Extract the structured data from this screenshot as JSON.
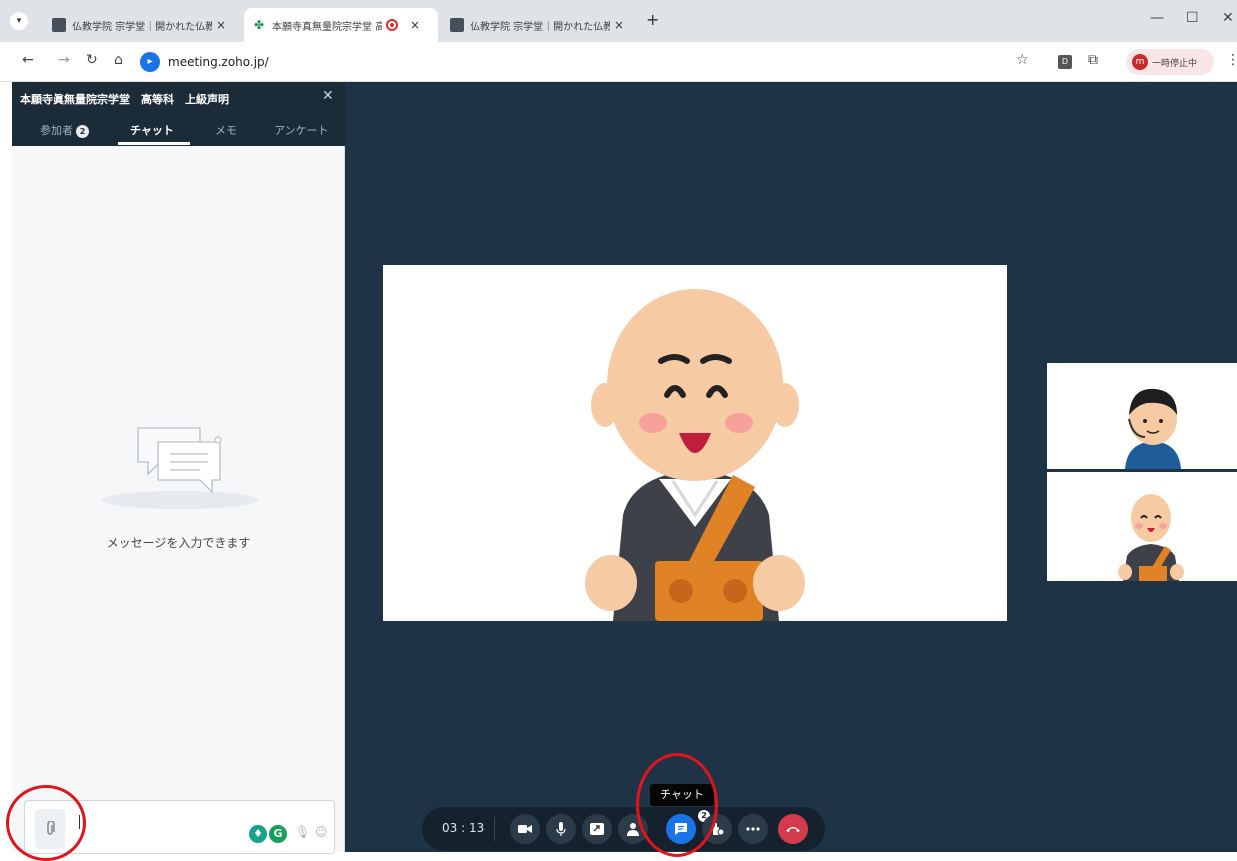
{
  "browser": {
    "tabs": [
      {
        "title": "仏教学院 宗学堂｜開かれた仏教",
        "active": false
      },
      {
        "title": "本願寺真無量院宗学堂 高",
        "active": true
      },
      {
        "title": "仏教学院 宗学堂｜開かれた仏教",
        "active": false
      }
    ],
    "new_tab_label": "+",
    "close_label": "×",
    "url": "meeting.zoho.jp/",
    "profile_initial": "m",
    "profile_label": "一時停止中"
  },
  "chat_panel": {
    "title": "本願寺眞無量院宗学堂　高等科　上級声明",
    "tabs": [
      {
        "label": "参加者",
        "badge": "2"
      },
      {
        "label": "チャット"
      },
      {
        "label": "メモ"
      },
      {
        "label": "アンケート"
      }
    ],
    "empty_message": "メッセージを入力できます"
  },
  "meeting": {
    "timer": "03 : 13",
    "participant_count": "2",
    "tooltip": "チャット"
  },
  "colors": {
    "panel_header": "#1c2b38",
    "stage_bg": "#1e3345",
    "chat_button": "#1b73e8",
    "end_call": "#d33b4c",
    "annotation": "#e3131b"
  }
}
